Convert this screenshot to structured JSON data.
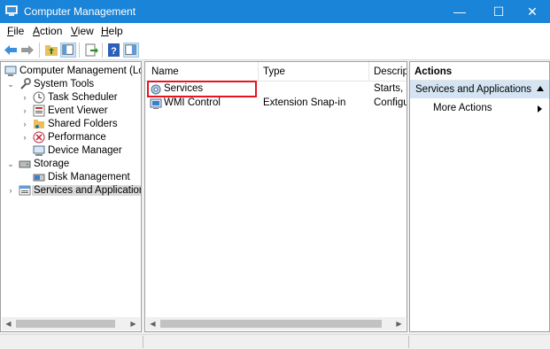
{
  "window": {
    "title": "Computer Management",
    "minimize": "—",
    "maximize": "☐",
    "close": "✕"
  },
  "menu": {
    "file_acc": "F",
    "file_rest": "ile",
    "action_acc": "A",
    "action_rest": "ction",
    "view_acc": "V",
    "view_rest": "iew",
    "help_acc": "H",
    "help_rest": "elp"
  },
  "tree": {
    "root": "Computer Management (Local",
    "system_tools": "System Tools",
    "task_scheduler": "Task Scheduler",
    "event_viewer": "Event Viewer",
    "shared_folders": "Shared Folders",
    "performance": "Performance",
    "device_manager": "Device Manager",
    "storage": "Storage",
    "disk_management": "Disk Management",
    "services_apps": "Services and Applications"
  },
  "list": {
    "columns": {
      "name": "Name",
      "type": "Type",
      "description": "Descript"
    },
    "rows": [
      {
        "name": "Services",
        "type": "",
        "description": "Starts, st"
      },
      {
        "name": "WMI Control",
        "type": "Extension Snap-in",
        "description": "Configu"
      }
    ]
  },
  "actions": {
    "header": "Actions",
    "section": "Services and Applications",
    "more": "More Actions"
  },
  "colors": {
    "titlebar": "#1a84d8",
    "highlight_box": "#e8141e",
    "actions_section": "#d4e4f3",
    "selected_tree": "#d9d9d9"
  }
}
